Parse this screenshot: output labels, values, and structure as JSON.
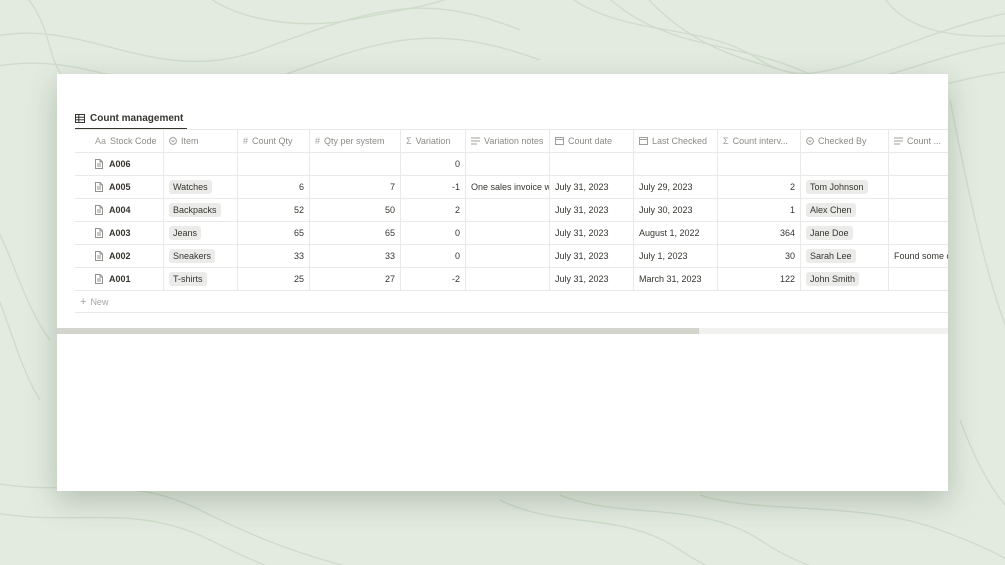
{
  "view": {
    "label": "Count management",
    "icon": "table-icon"
  },
  "columns": [
    {
      "label": "Stock Code",
      "icon": "Aa"
    },
    {
      "label": "Item",
      "icon": "select-icon"
    },
    {
      "label": "Count Qty",
      "icon": "#"
    },
    {
      "label": "Qty per system",
      "icon": "#"
    },
    {
      "label": "Variation",
      "icon": "Σ"
    },
    {
      "label": "Variation notes",
      "icon": "text-icon"
    },
    {
      "label": "Count date",
      "icon": "calendar-icon"
    },
    {
      "label": "Last Checked",
      "icon": "calendar-icon"
    },
    {
      "label": "Count interv...",
      "icon": "Σ"
    },
    {
      "label": "Checked By",
      "icon": "select-icon"
    },
    {
      "label": "Count ...",
      "icon": "text-icon"
    }
  ],
  "rows": [
    {
      "code": "A006",
      "item": "",
      "count_qty": "",
      "qty_system": "",
      "variation": "0",
      "notes": "",
      "count_date": "",
      "last_checked": "",
      "interval": "",
      "checked_by": "",
      "count_notes": ""
    },
    {
      "code": "A005",
      "item": "Watches",
      "count_qty": "6",
      "qty_system": "7",
      "variation": "-1",
      "notes": "One sales invoice wa",
      "count_date": "July 31, 2023",
      "last_checked": "July 29, 2023",
      "interval": "2",
      "checked_by": "Tom Johnson",
      "count_notes": ""
    },
    {
      "code": "A004",
      "item": "Backpacks",
      "count_qty": "52",
      "qty_system": "50",
      "variation": "2",
      "notes": "",
      "count_date": "July 31, 2023",
      "last_checked": "July 30, 2023",
      "interval": "1",
      "checked_by": "Alex Chen",
      "count_notes": ""
    },
    {
      "code": "A003",
      "item": "Jeans",
      "count_qty": "65",
      "qty_system": "65",
      "variation": "0",
      "notes": "",
      "count_date": "July 31, 2023",
      "last_checked": "August 1, 2022",
      "interval": "364",
      "checked_by": "Jane Doe",
      "count_notes": ""
    },
    {
      "code": "A002",
      "item": "Sneakers",
      "count_qty": "33",
      "qty_system": "33",
      "variation": "0",
      "notes": "",
      "count_date": "July 31, 2023",
      "last_checked": "July 1, 2023",
      "interval": "30",
      "checked_by": "Sarah Lee",
      "count_notes": "Found some d"
    },
    {
      "code": "A001",
      "item": "T-shirts",
      "count_qty": "25",
      "qty_system": "27",
      "variation": "-2",
      "notes": "",
      "count_date": "July 31, 2023",
      "last_checked": "March 31, 2023",
      "interval": "122",
      "checked_by": "John Smith",
      "count_notes": ""
    }
  ],
  "new_row_label": "New",
  "colors": {
    "background": "#e3ebe0",
    "contour": "#cfdccb",
    "card": "#ffffff",
    "tag": "#ebebea",
    "scroll_thumb": "#d3d4cc"
  },
  "scroll": {
    "visible_fraction": 0.72
  }
}
